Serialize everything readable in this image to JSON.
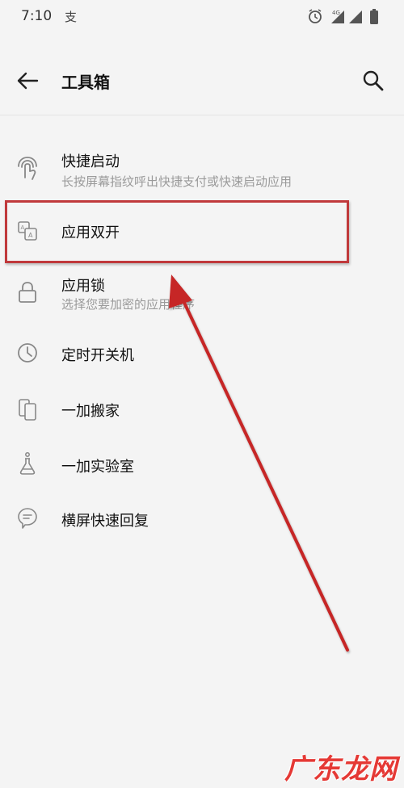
{
  "status_bar": {
    "time": "7:10",
    "notification_glyph": "支",
    "network": "4G"
  },
  "app_bar": {
    "title": "工具箱",
    "back_icon": "back-arrow-icon",
    "search_icon": "search-icon"
  },
  "items": [
    {
      "id": "quick-launch",
      "label": "快捷启动",
      "subtitle": "长按屏幕指纹呼出快捷支付或快速启动应用",
      "icon": "fingerprint-icon"
    },
    {
      "id": "parallel-apps",
      "label": "应用双开",
      "subtitle": "",
      "icon": "parallel-apps-icon"
    },
    {
      "id": "app-locker",
      "label": "应用锁",
      "subtitle": "选择您要加密的应用程序",
      "icon": "lock-icon"
    },
    {
      "id": "scheduled-power",
      "label": "定时开关机",
      "subtitle": "",
      "icon": "clock-icon"
    },
    {
      "id": "oneplus-switch",
      "label": "一加搬家",
      "subtitle": "",
      "icon": "phone-switch-icon"
    },
    {
      "id": "oneplus-lab",
      "label": "一加实验室",
      "subtitle": "",
      "icon": "lab-flask-icon"
    },
    {
      "id": "quick-reply",
      "label": "横屏快速回复",
      "subtitle": "",
      "icon": "chat-bubble-icon"
    }
  ],
  "annotation": {
    "highlight_color": "#c0393b",
    "arrow_color": "#c62828"
  },
  "watermark": {
    "text": "广东龙网"
  }
}
